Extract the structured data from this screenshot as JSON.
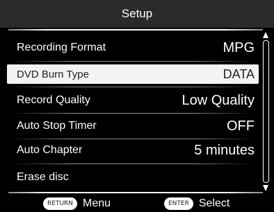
{
  "header": {
    "title": "Setup"
  },
  "menu": {
    "items": [
      {
        "label": "Recording Format",
        "value": "MPG",
        "selected": false
      },
      {
        "label": "DVD Burn Type",
        "value": "DATA",
        "selected": true
      },
      {
        "label": "Record Quality",
        "value": "Low Quality",
        "selected": false
      },
      {
        "label": "Auto Stop Timer",
        "value": "OFF",
        "selected": false
      },
      {
        "label": "Auto Chapter",
        "value": "5 minutes",
        "selected": false
      },
      {
        "label": "Erase disc",
        "value": "",
        "selected": false
      }
    ]
  },
  "footer": {
    "return_key": "RETURN",
    "return_label": "Menu",
    "enter_key": "ENTER",
    "enter_label": "Select"
  },
  "colors": {
    "background": "#000000",
    "header_bg": "#2a2a2a",
    "selected_bg": "#f3f3f3",
    "selected_text": "#222222",
    "text": "#ffffff"
  }
}
